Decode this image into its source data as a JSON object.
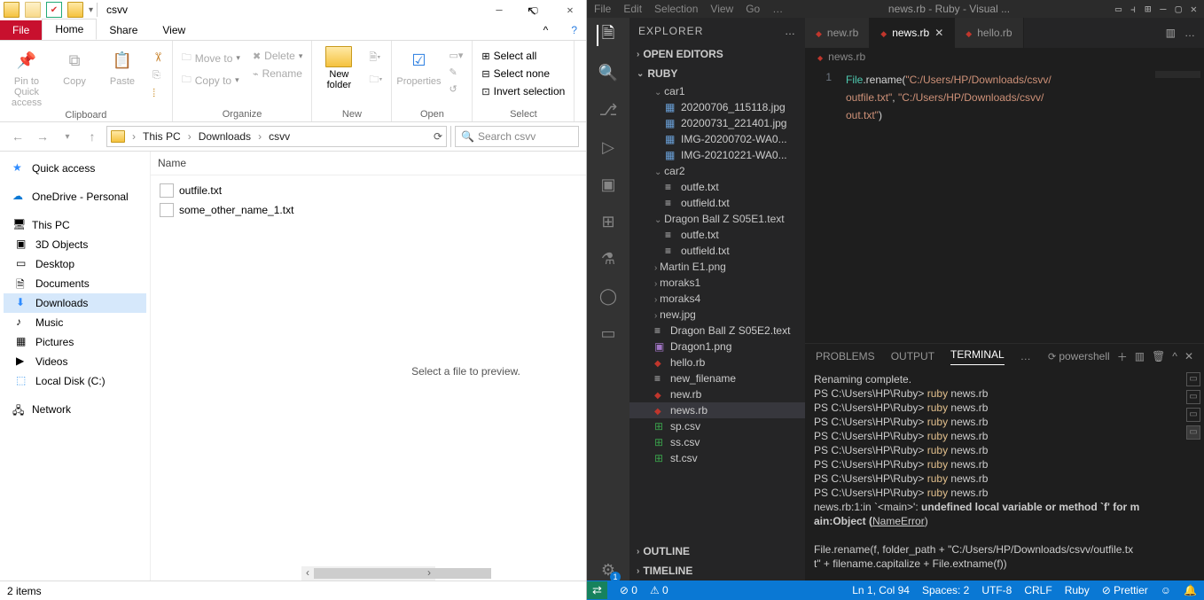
{
  "explorer": {
    "title": "csvv",
    "window_controls": {
      "min": "—",
      "max": "▢",
      "close": "✕",
      "help": "?"
    },
    "tabs": {
      "file": "File",
      "home": "Home",
      "share": "Share",
      "view": "View",
      "collapse": "^"
    },
    "ribbon": {
      "clipboard": {
        "label": "Clipboard",
        "pin": "Pin to Quick access",
        "copy": "Copy",
        "paste": "Paste"
      },
      "organize": {
        "label": "Organize",
        "move": "Move to",
        "copyto": "Copy to",
        "delete": "Delete",
        "rename": "Rename"
      },
      "new": {
        "label": "New",
        "newfolder": "New folder"
      },
      "open": {
        "label": "Open",
        "properties": "Properties"
      },
      "select": {
        "label": "Select",
        "all": "Select all",
        "none": "Select none",
        "invert": "Invert selection"
      }
    },
    "breadcrumb": [
      "This PC",
      "Downloads",
      "csvv"
    ],
    "search_placeholder": "Search csvv",
    "nav": {
      "quick": "Quick access",
      "onedrive": "OneDrive - Personal",
      "thispc": "This PC",
      "items": [
        "3D Objects",
        "Desktop",
        "Documents",
        "Downloads",
        "Music",
        "Pictures",
        "Videos",
        "Local Disk (C:)"
      ],
      "network": "Network"
    },
    "column_header": "Name",
    "files": [
      "outfile.txt",
      "some_other_name_1.txt"
    ],
    "preview_text": "Select a file to preview.",
    "status": "2 items"
  },
  "vscode": {
    "menu": [
      "File",
      "Edit",
      "Selection",
      "View",
      "Go"
    ],
    "title_center": "news.rb - Ruby - Visual ...",
    "title_right": [
      "▢",
      "⫞",
      "□",
      "—",
      "▢",
      "✕"
    ],
    "sidebar": {
      "header": "EXPLORER",
      "open_editors": "OPEN EDITORS",
      "root": "RUBY",
      "tree": [
        {
          "t": "car1",
          "type": "fold",
          "open": true,
          "d": 1
        },
        {
          "t": "20200706_115118.jpg",
          "type": "img",
          "d": 2
        },
        {
          "t": "20200731_221401.jpg",
          "type": "img",
          "d": 2
        },
        {
          "t": "IMG-20200702-WA0...",
          "type": "img",
          "d": 2
        },
        {
          "t": "IMG-20210221-WA0...",
          "type": "img",
          "d": 2
        },
        {
          "t": "car2",
          "type": "fold",
          "open": true,
          "d": 1
        },
        {
          "t": "outfe.txt",
          "type": "txt",
          "d": 2
        },
        {
          "t": "outfield.txt",
          "type": "txt",
          "d": 2
        },
        {
          "t": "Dragon Ball Z S05E1.text",
          "type": "fold",
          "open": true,
          "d": 1
        },
        {
          "t": "outfe.txt",
          "type": "txt",
          "d": 2
        },
        {
          "t": "outfield.txt",
          "type": "txt",
          "d": 2
        },
        {
          "t": "Martin E1.png",
          "type": "fold",
          "open": false,
          "d": 1
        },
        {
          "t": "moraks1",
          "type": "fold",
          "open": false,
          "d": 1
        },
        {
          "t": "moraks4",
          "type": "fold",
          "open": false,
          "d": 1
        },
        {
          "t": "new.jpg",
          "type": "fold",
          "open": false,
          "d": 1
        },
        {
          "t": "Dragon Ball Z S05E2.text",
          "type": "txt",
          "d": 1
        },
        {
          "t": "Dragon1.png",
          "type": "png",
          "d": 1
        },
        {
          "t": "hello.rb",
          "type": "rb",
          "d": 1
        },
        {
          "t": "new_filename",
          "type": "txt",
          "d": 1
        },
        {
          "t": "new.rb",
          "type": "rb",
          "d": 1
        },
        {
          "t": "news.rb",
          "type": "rb",
          "d": 1,
          "sel": true
        },
        {
          "t": "sp.csv",
          "type": "csv",
          "d": 1
        },
        {
          "t": "ss.csv",
          "type": "csv",
          "d": 1
        },
        {
          "t": "st.csv",
          "type": "csv",
          "d": 1
        }
      ],
      "outline": "OUTLINE",
      "timeline": "TIMELINE"
    },
    "tabs": [
      {
        "name": "new.rb",
        "active": false
      },
      {
        "name": "news.rb",
        "active": true,
        "close": true
      },
      {
        "name": "hello.rb",
        "active": false
      }
    ],
    "breadcrumb": "news.rb",
    "code": {
      "line": "1",
      "l1a": "File",
      "l1b": ".rename(",
      "l1c": "\"C:/Users/HP/Downloads/csvv/",
      "l2": "outfile.txt\"",
      "l2b": ", ",
      "l2c": "\"C:/Users/HP/Downloads/csvv/",
      "l3": "out.txt\"",
      "l3b": ")"
    },
    "panel": {
      "tabs": {
        "problems": "PROBLEMS",
        "output": "OUTPUT",
        "terminal": "TERMINAL"
      },
      "shell": "powershell",
      "lines": [
        "Renaming complete.",
        "PS C:\\Users\\HP\\Ruby> ruby news.rb",
        "PS C:\\Users\\HP\\Ruby> ruby news.rb",
        "PS C:\\Users\\HP\\Ruby> ruby news.rb",
        "PS C:\\Users\\HP\\Ruby> ruby news.rb",
        "PS C:\\Users\\HP\\Ruby> ruby news.rb",
        "PS C:\\Users\\HP\\Ruby> ruby news.rb",
        "PS C:\\Users\\HP\\Ruby> ruby news.rb",
        "PS C:\\Users\\HP\\Ruby> ruby news.rb"
      ],
      "err1": "news.rb:1:in `<main>': ",
      "err2": "undefined local variable or method `f' for m",
      "err3": "ain:Object (",
      "err4": "NameError",
      "err5": ")",
      "trace1": "File.rename(f, folder_path + \"C:/Users/HP/Downloads/csvv/outfile.tx",
      "trace2": "t\" + filename.capitalize + File.extname(f))",
      "prompt": "PS C:\\Users\\HP\\Ruby> ",
      "prompt_cmd": "ruby news.rb"
    },
    "status": {
      "remote": "⇄",
      "errors": "⊘ 0",
      "warnings": "⚠ 0",
      "pos": "Ln 1, Col 94",
      "spaces": "Spaces: 2",
      "enc": "UTF-8",
      "eol": "CRLF",
      "lang": "Ruby",
      "prettier": "Prettier",
      "feedback": "☺",
      "bell": "🔔"
    }
  }
}
